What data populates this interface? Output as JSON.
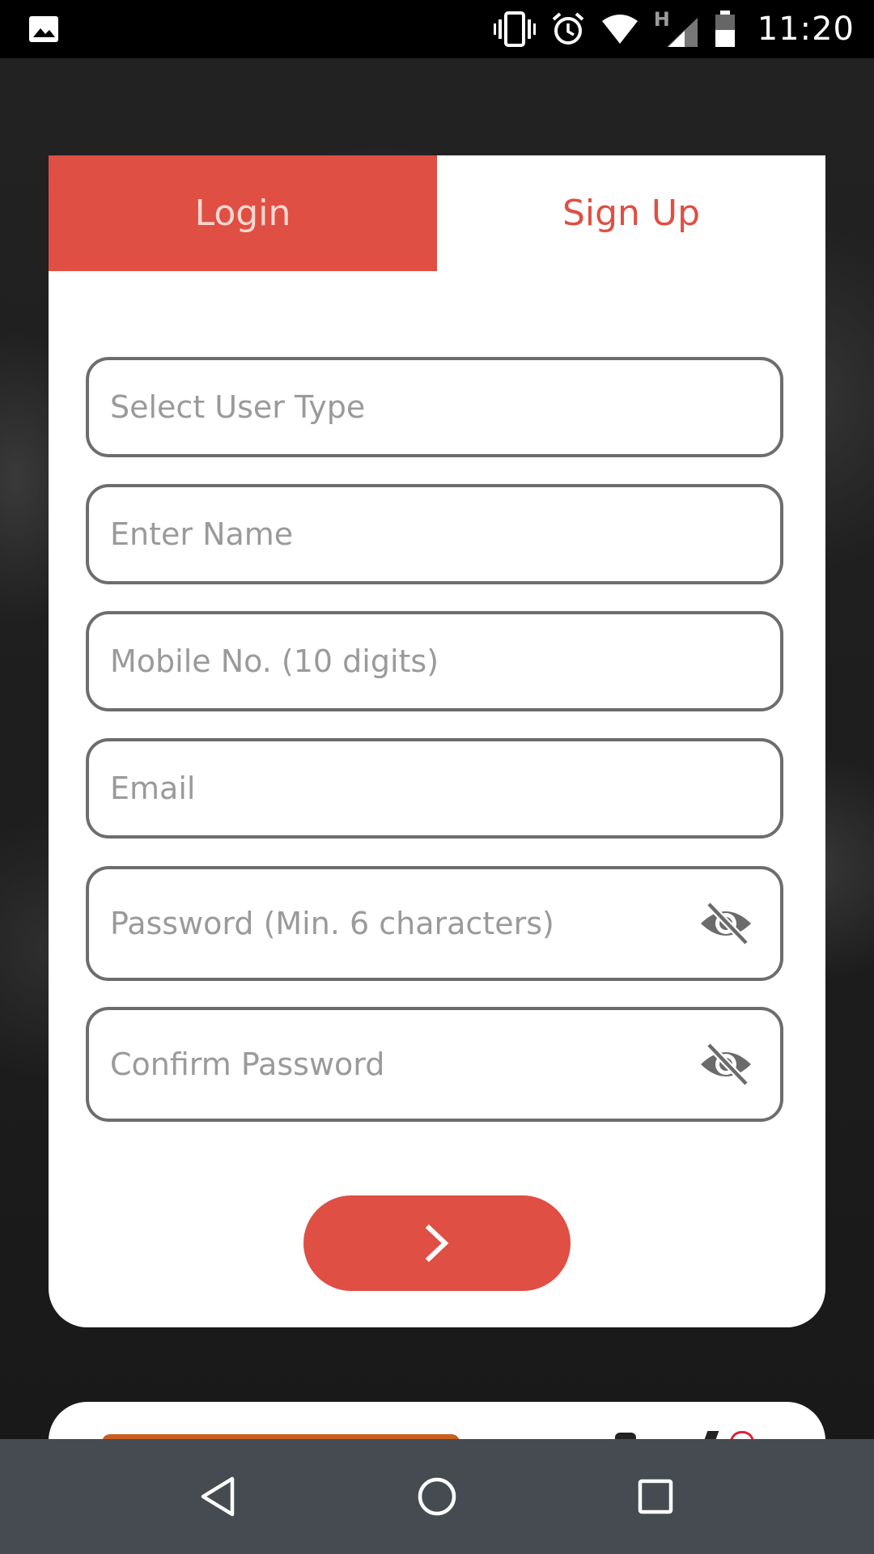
{
  "status_bar": {
    "time": "11:20",
    "network_type": "H",
    "icons": [
      "image-icon",
      "vibrate-icon",
      "alarm-icon",
      "wifi-icon",
      "signal-icon",
      "battery-icon"
    ]
  },
  "tabs": {
    "login_label": "Login",
    "signup_label": "Sign Up",
    "active": "Sign Up"
  },
  "form": {
    "user_type_placeholder": "Select User Type",
    "name_placeholder": "Enter Name",
    "mobile_placeholder": "Mobile No. (10 digits)",
    "email_placeholder": "Email",
    "password_placeholder": "Password (Min. 6 characters)",
    "confirm_password_placeholder": "Confirm Password",
    "submit_icon": "chevron-right-icon"
  },
  "colors": {
    "accent": "#df4f43",
    "field_border": "#6d6d6d",
    "placeholder": "#9a9a9a",
    "nav_bar": "#454b51"
  },
  "nav_bar": {
    "icons": [
      "back-icon",
      "home-icon",
      "recents-icon"
    ]
  }
}
